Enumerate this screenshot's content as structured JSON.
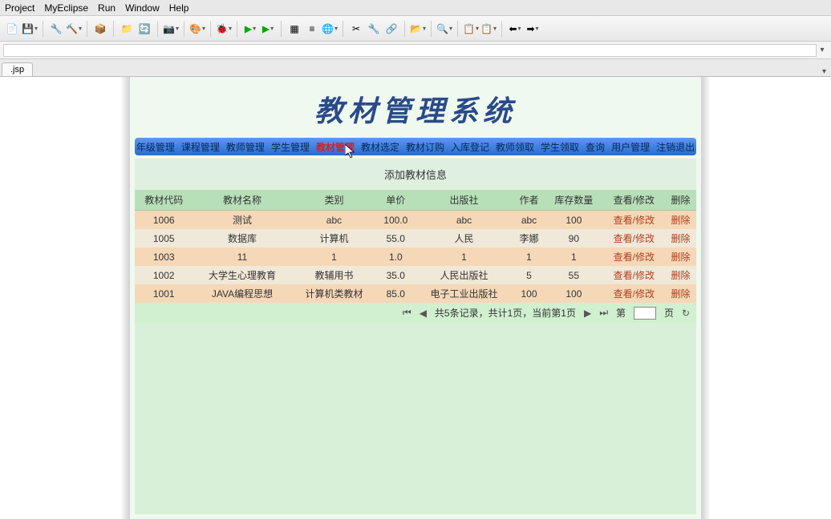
{
  "menubar": [
    "Project",
    "MyEclipse",
    "Run",
    "Window",
    "Help"
  ],
  "tab_label": ".jsp",
  "app_title": "教材管理系统",
  "nav_items": [
    {
      "label": "年级管理",
      "active": false
    },
    {
      "label": "课程管理",
      "active": false
    },
    {
      "label": "教师管理",
      "active": false
    },
    {
      "label": "学生管理",
      "active": false
    },
    {
      "label": "教材管理",
      "active": true
    },
    {
      "label": "教材选定",
      "active": false
    },
    {
      "label": "教材订购",
      "active": false
    },
    {
      "label": "入库登记",
      "active": false
    },
    {
      "label": "教师领取",
      "active": false
    },
    {
      "label": "学生领取",
      "active": false
    },
    {
      "label": "查询",
      "active": false
    },
    {
      "label": "用户管理",
      "active": false
    },
    {
      "label": "注销退出",
      "active": false
    }
  ],
  "section_title": "添加教材信息",
  "columns": [
    "教材代码",
    "教材名称",
    "类别",
    "单价",
    "出版社",
    "作者",
    "库存数量",
    "查看/修改",
    "删除"
  ],
  "rows": [
    {
      "code": "1006",
      "name": "测试",
      "cat": "abc",
      "price": "100.0",
      "pub": "abc",
      "author": "abc",
      "stock": "100",
      "view": "查看/修改",
      "del": "删除"
    },
    {
      "code": "1005",
      "name": "数据库",
      "cat": "计算机",
      "price": "55.0",
      "pub": "人民",
      "author": "李娜",
      "stock": "90",
      "view": "查看/修改",
      "del": "删除"
    },
    {
      "code": "1003",
      "name": "11",
      "cat": "1",
      "price": "1.0",
      "pub": "1",
      "author": "1",
      "stock": "1",
      "view": "查看/修改",
      "del": "删除"
    },
    {
      "code": "1002",
      "name": "大学生心理教育",
      "cat": "教辅用书",
      "price": "35.0",
      "pub": "人民出版社",
      "author": "5",
      "stock": "55",
      "view": "查看/修改",
      "del": "删除"
    },
    {
      "code": "1001",
      "name": "JAVA编程思想",
      "cat": "计算机类教材",
      "price": "85.0",
      "pub": "电子工业出版社",
      "author": "100",
      "stock": "100",
      "view": "查看/修改",
      "del": "删除"
    }
  ],
  "pager": {
    "first": "⏮",
    "prev": "◀",
    "info": "共5条记录，共计1页，当前第1页",
    "next": "▶",
    "last": "⏭",
    "page_label_pre": "第",
    "page_label_post": "页",
    "go": "↻",
    "page_value": ""
  }
}
